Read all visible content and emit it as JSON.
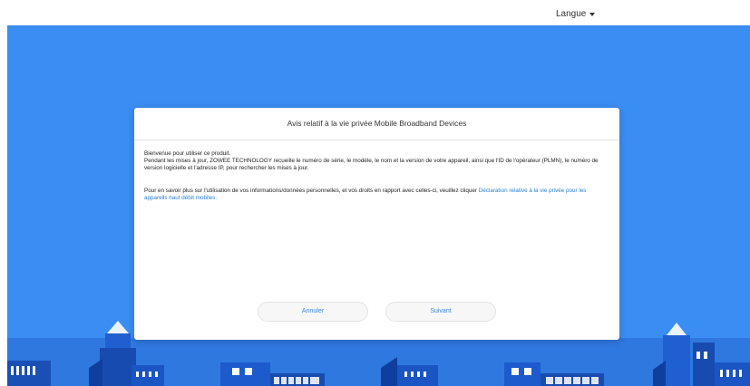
{
  "header": {
    "language_label": "Langue"
  },
  "dialog": {
    "title": "Avis relatif à la vie privée Mobile Broadband Devices",
    "line1": "Bienvenue pour utiliser ce produit.",
    "line2": "Pendant les mises à jour, ZOWEE TECHNOLOGY recueille le numéro de série, le modèle, le nom et la version de votre appareil, ainsi que l'ID de l'opérateur (PLMN), le numéro de version logicielle et l'adresse IP, pour rechercher les mises à jour.",
    "line3": "Pour en savoir plus sur l'utilisation de vos informations/données personnelles, et vos droits en rapport avec celles-ci, veuillez cliquer",
    "link": "Déclaration relative à la vie privée pour les appareils haut débit mobiles.",
    "cancel_label": "Annuler",
    "next_label": "Suivant"
  },
  "colors": {
    "hero": "#3a8df2",
    "accent": "#2a7fd6",
    "button_text": "#3f87db"
  },
  "icons": {
    "language_dropdown": "caret-down-icon"
  }
}
